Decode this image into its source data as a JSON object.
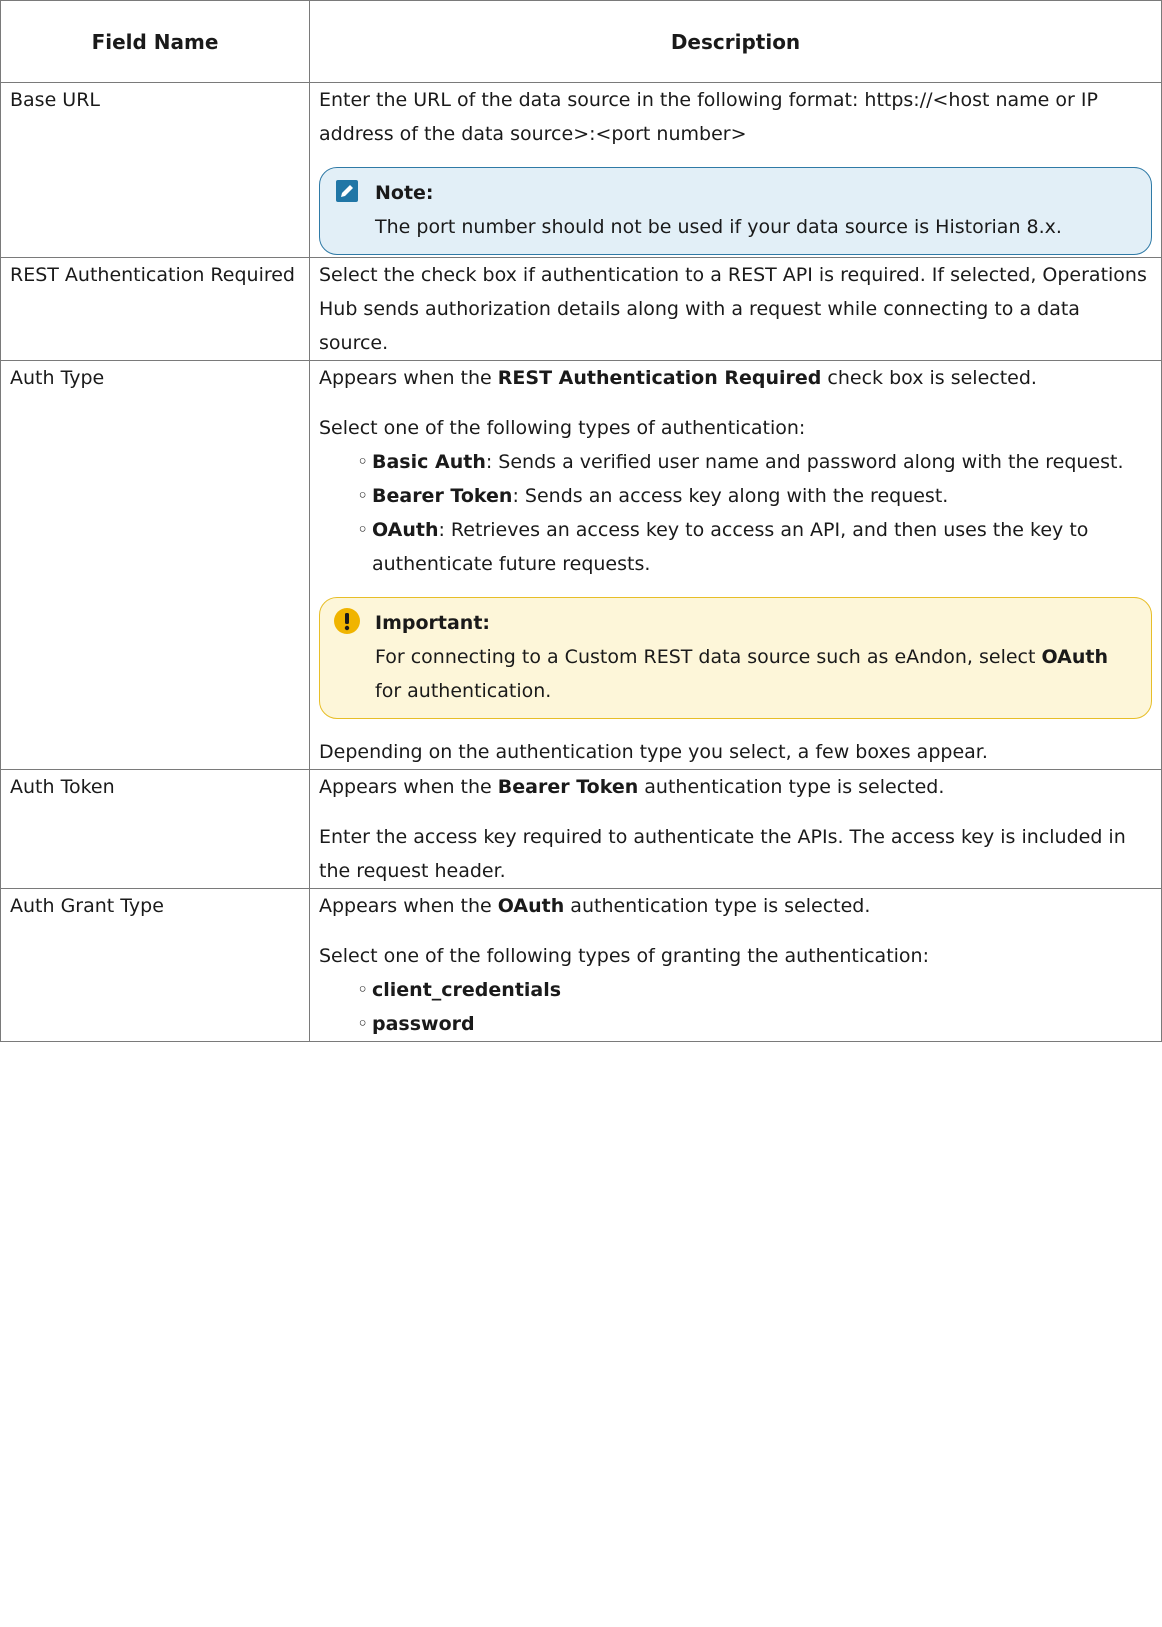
{
  "headers": {
    "field_name": "Field Name",
    "description": "Description"
  },
  "rows": {
    "base_url": {
      "name": "Base URL",
      "p1": "Enter the URL of the data source in the following format: https://<host name or IP address of the data source>:<port number>",
      "note_title": "Note:",
      "note_text": "The port number should not be used if your data source is Historian 8.x."
    },
    "rest_auth": {
      "name": "REST Authentication Required",
      "p1": "Select the check box if authentication to a REST API is required. If selected, Operations Hub sends authorization details along with a request while connecting to a data source."
    },
    "auth_type": {
      "name": "Auth Type",
      "p1_pre": "Appears when the ",
      "p1_bold": "REST Authentication Required",
      "p1_post": " check box is selected.",
      "p2": "Select one of the following types of authentication:",
      "options": [
        {
          "bullet": "◦",
          "label": "Basic Auth",
          "text": ": Sends a verified user name and password along with the request."
        },
        {
          "bullet": "◦",
          "label": "Bearer Token",
          "text": ": Sends an access key along with the request."
        },
        {
          "bullet": "◦",
          "label": "OAuth",
          "text": ": Retrieves an access key to access an API, and then uses the key to authenticate future requests."
        }
      ],
      "important_title": "Important:",
      "important_pre": "For connecting to a Custom REST data source such as eAndon, select ",
      "important_bold": "OAuth",
      "important_post": " for authentication.",
      "p3": "Depending on the authentication type you select, a few boxes appear."
    },
    "auth_token": {
      "name": "Auth Token",
      "p1_pre": "Appears when the ",
      "p1_bold": "Bearer Token",
      "p1_post": " authentication type is selected.",
      "p2": "Enter the access key required to authenticate the APIs. The access key is included in the request header."
    },
    "auth_grant": {
      "name": "Auth Grant Type",
      "p1_pre": "Appears when the ",
      "p1_bold": "OAuth",
      "p1_post": " authentication type is selected.",
      "p2": "Select one of the following types of granting the authentication:",
      "options": [
        {
          "bullet": "◦",
          "label": "client_credentials"
        },
        {
          "bullet": "◦",
          "label": "password"
        }
      ]
    }
  },
  "icons": {
    "note": "pencil-icon",
    "important": "exclamation-icon"
  },
  "colors": {
    "note_border": "#2f7aa6",
    "note_bg": "#e2eff7",
    "important_border": "#e7be28",
    "important_bg": "#fdf6d9"
  }
}
